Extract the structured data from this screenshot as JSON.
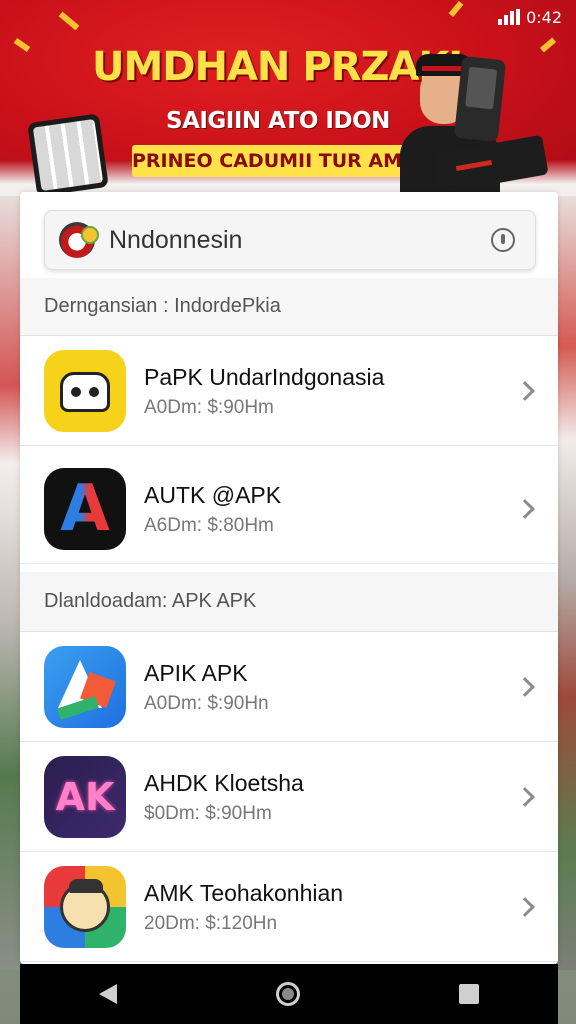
{
  "status_bar": {
    "time": "0:42"
  },
  "banner": {
    "title": "UMDHAN PRZAKI",
    "subtitle": "SAIGIIN ATO IDON",
    "ribbon": "PRINEO CADUMII TUR AMII"
  },
  "search": {
    "value": "Nndonnesin"
  },
  "sections": [
    {
      "header": "Derngansian :  IndordePkia",
      "apps": [
        {
          "name": "PaPK UndarIndgonasia",
          "meta": "A0Dm: $:90Hm",
          "icon": "yellow-car-icon"
        },
        {
          "name": "AUTK @APK",
          "meta": "A6Dm: $:80Hm",
          "icon": "a-letter-icon"
        }
      ]
    },
    {
      "header": "Dlanldoadam: APK APK",
      "apps": [
        {
          "name": "APIK APK",
          "meta": "A0Dm: $:90Hn",
          "icon": "blue-arrow-icon"
        },
        {
          "name": "AHDK Kloetsha",
          "meta": "$0Dm: $:90Hm",
          "icon": "ak-letter-icon"
        },
        {
          "name": "AMK Teohakonhian",
          "meta": "20Dm: $:120Hn",
          "icon": "character-face-icon"
        }
      ]
    }
  ],
  "icon_letters": {
    "a_icon": "A",
    "ak_icon": "AK"
  }
}
